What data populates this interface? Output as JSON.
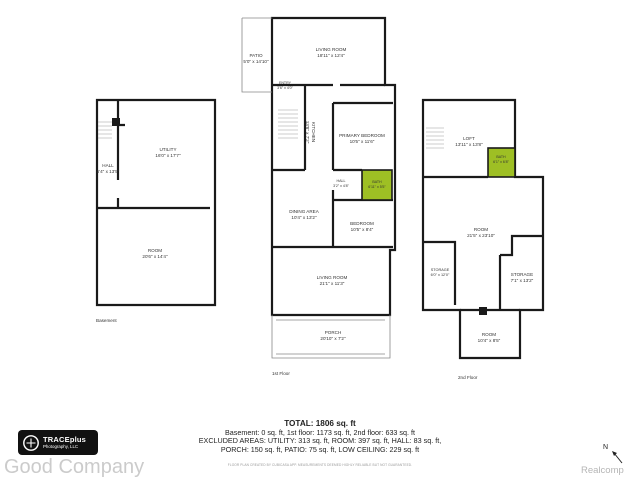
{
  "floors": {
    "basement": {
      "caption": "Basement",
      "rooms": {
        "hall": {
          "name": "HALL",
          "dims": "6'4\" x 13'5\""
        },
        "utility": {
          "name": "UTILITY",
          "dims": "16'0\" x 17'7\""
        },
        "room": {
          "name": "ROOM",
          "dims": "20'6\" x 14'4\""
        }
      }
    },
    "first": {
      "caption": "1st Floor",
      "rooms": {
        "patio": {
          "name": "PATIO",
          "dims": "5'0\" x 14'10\""
        },
        "living_top": {
          "name": "LIVING ROOM",
          "dims": "18'11\" x 12'4\""
        },
        "entry": {
          "name": "ENTRY",
          "dims": "3'6\" x 4'0\""
        },
        "kitchen": {
          "name": "KITCHEN",
          "dims": "13'8\" x 7'2\""
        },
        "primary_bedroom": {
          "name": "PRIMARY BEDROOM",
          "dims": "10'5\" x 11'6\""
        },
        "hall": {
          "name": "HALL",
          "dims": "3'2\" x 4'8\""
        },
        "bath": {
          "name": "BATH",
          "dims": "6'11\" x 5'5\""
        },
        "dining": {
          "name": "DINING AREA",
          "dims": "10'4\" x 13'2\""
        },
        "bedroom": {
          "name": "BEDROOM",
          "dims": "10'5\" x 8'4\""
        },
        "living_bottom": {
          "name": "LIVING ROOM",
          "dims": "21'1\" x 11'3\""
        },
        "porch": {
          "name": "PORCH",
          "dims": "20'10\" x 7'2\""
        }
      }
    },
    "second": {
      "caption": "2nd Floor",
      "rooms": {
        "loft": {
          "name": "LOFT",
          "dims": "13'11\" x 13'8\""
        },
        "bath": {
          "name": "BATH",
          "dims": "6'1\" x 6'8\""
        },
        "room": {
          "name": "ROOM",
          "dims": "21'5\" x 23'10\""
        },
        "storage_left": {
          "name": "STORAGE",
          "dims": "6'0\" x 12'0\""
        },
        "storage_right": {
          "name": "STORAGE",
          "dims": "7'1\" x 13'2\""
        },
        "room_bottom": {
          "name": "ROOM",
          "dims": "10'4\" x 8'5\""
        }
      }
    }
  },
  "totals": {
    "line1": "TOTAL: 1806 sq. ft",
    "line2": "Basement: 0 sq. ft, 1st floor: 1173 sq. ft, 2nd floor: 633 sq. ft",
    "line3": "EXCLUDED AREAS: UTILITY: 313 sq. ft, ROOM: 397 sq. ft, HALL: 83 sq. ft,",
    "line4": "PORCH: 150 sq. ft, PATIO: 75 sq. ft, LOW CEILING: 229 sq. ft"
  },
  "disclaimer": "FLOOR PLAN CREATED BY CUBICASA APP. MEASUREMENTS DEEMED HIGHLY RELIABLE BUT NOT GUARANTEED.",
  "logo": {
    "line1": "TRACEplus",
    "line2": "Photography, LLC"
  },
  "watermark_left": "Good Company",
  "watermark_right": "Realcomp",
  "compass_label": "N",
  "colors": {
    "wall": "#1a1a1a",
    "bath_fill": "#9ebf24",
    "background": "#ffffff"
  }
}
